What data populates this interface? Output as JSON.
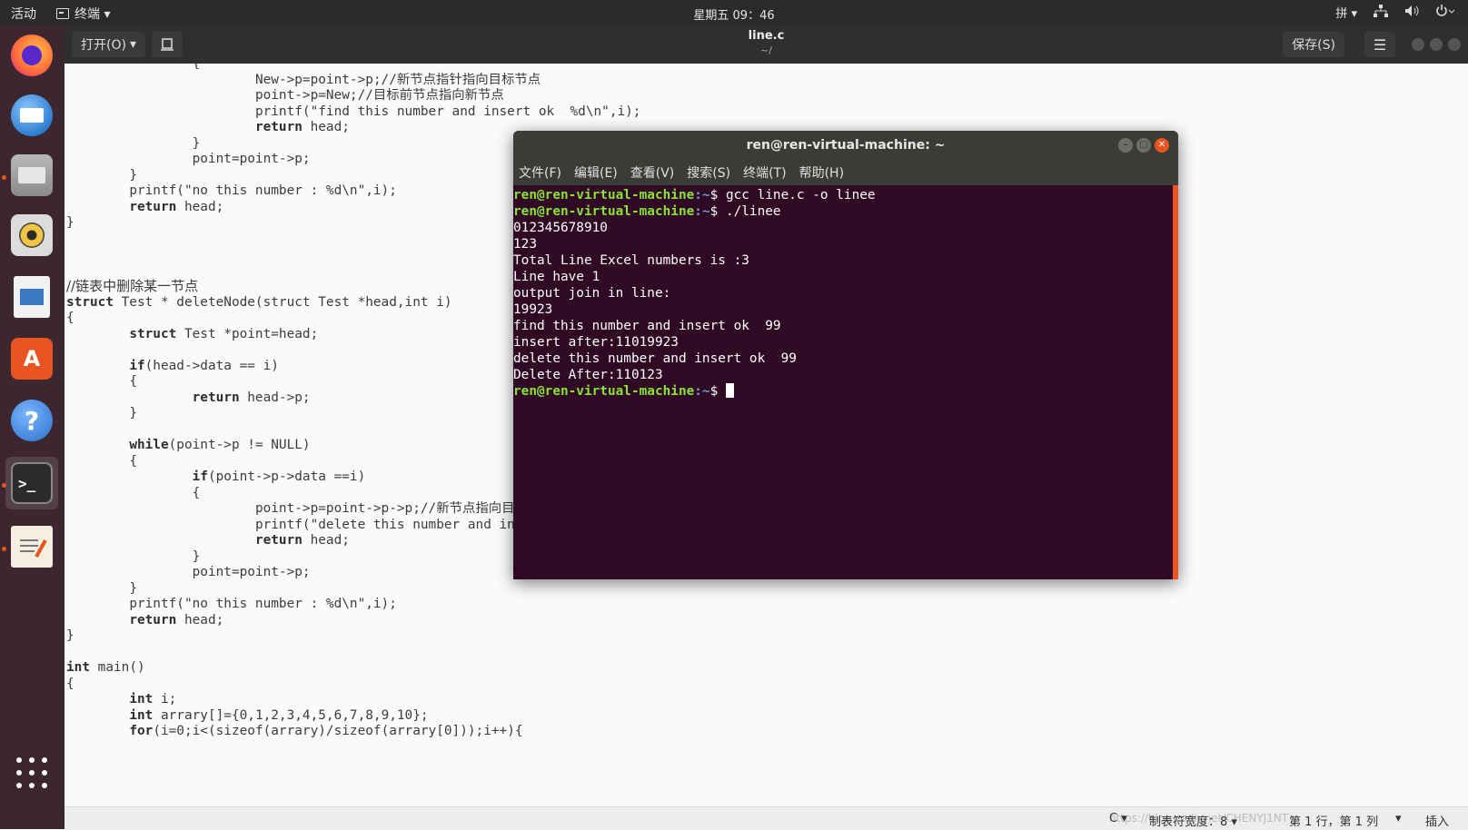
{
  "topbar": {
    "activities": "活动",
    "app_menu": "终端 ▾",
    "clock": "星期五 09：46",
    "input_method": "拼 ▾"
  },
  "dock": {
    "items": [
      {
        "name": "firefox",
        "color": "#ff7139"
      },
      {
        "name": "thunderbird",
        "color": "#2f7fd0"
      },
      {
        "name": "files",
        "color": "#8a8a8a"
      },
      {
        "name": "rhythmbox",
        "color": "#f4c542"
      },
      {
        "name": "libreoffice-writer",
        "color": "#3b7bc5"
      },
      {
        "name": "software",
        "color": "#e95420"
      },
      {
        "name": "help",
        "color": "#3d8ee0"
      },
      {
        "name": "terminal",
        "color": "#2b2b2b"
      },
      {
        "name": "text-editor",
        "color": "#e8e0c8"
      }
    ]
  },
  "editor": {
    "open_label": "打开(O)",
    "title": "line.c",
    "subtitle": "~/",
    "save_label": "保存(S)",
    "code_lines": [
      {
        "i": "\t\t",
        "t": "{"
      },
      {
        "i": "\t\t\t",
        "t": "New->p=point->p;//新节点指针指向目标节点"
      },
      {
        "i": "\t\t\t",
        "t": "point->p=New;//目标前节点指向新节点"
      },
      {
        "i": "\t\t\t",
        "t": "printf(\"find this number and insert ok  %d\\n\",i);"
      },
      {
        "i": "\t\t\t",
        "k": "return",
        "t": " head;"
      },
      {
        "i": "\t\t",
        "t": "}"
      },
      {
        "i": "\t\t",
        "t": "point=point->p;"
      },
      {
        "i": "\t",
        "t": "}"
      },
      {
        "i": "\t",
        "t": "printf(\"no this number : %d\\n\",i);"
      },
      {
        "i": "\t",
        "k": "return",
        "t": " head;"
      },
      {
        "i": "",
        "t": "}"
      },
      {
        "i": "",
        "t": ""
      },
      {
        "i": "",
        "t": ""
      },
      {
        "i": "",
        "t": ""
      },
      {
        "i": "",
        "t": "//链表中删除某一节点"
      },
      {
        "i": "",
        "k": "struct",
        "t": " Test * deleteNode(struct Test *head,int i)"
      },
      {
        "i": "",
        "t": "{"
      },
      {
        "i": "\t",
        "k": "struct",
        "t": " Test *point=head;"
      },
      {
        "i": "",
        "t": ""
      },
      {
        "i": "\t",
        "k": "if",
        "t": "(head->data == i)"
      },
      {
        "i": "\t",
        "t": "{"
      },
      {
        "i": "\t\t",
        "k": "return",
        "t": " head->p;"
      },
      {
        "i": "\t",
        "t": "}"
      },
      {
        "i": "",
        "t": ""
      },
      {
        "i": "\t",
        "k": "while",
        "t": "(point->p != NULL)"
      },
      {
        "i": "\t",
        "t": "{"
      },
      {
        "i": "\t\t",
        "k": "if",
        "t": "(point->p->data ==i)"
      },
      {
        "i": "\t\t",
        "t": "{"
      },
      {
        "i": "\t\t\t",
        "t": "point->p=point->p->p;//新节点指向目标后节点"
      },
      {
        "i": "\t\t\t",
        "t": "printf(\"delete this number and insert ok  %d\\n\",i);"
      },
      {
        "i": "\t\t\t",
        "k": "return",
        "t": " head;"
      },
      {
        "i": "\t\t",
        "t": "}"
      },
      {
        "i": "\t\t",
        "t": "point=point->p;"
      },
      {
        "i": "\t",
        "t": "}"
      },
      {
        "i": "\t",
        "t": "printf(\"no this number : %d\\n\",i);"
      },
      {
        "i": "\t",
        "k": "return",
        "t": " head;"
      },
      {
        "i": "",
        "t": "}"
      },
      {
        "i": "",
        "t": ""
      },
      {
        "i": "",
        "k": "int",
        "t": " main()"
      },
      {
        "i": "",
        "t": "{"
      },
      {
        "i": "\t",
        "k": "int",
        "t": " i;"
      },
      {
        "i": "\t",
        "k": "int",
        "t": " arrary[]={0,1,2,3,4,5,6,7,8,9,10};"
      },
      {
        "i": "\t",
        "k": "for",
        "t": "(i=0;i<(sizeof(arrary)/sizeof(arrary[0]));i++){"
      }
    ]
  },
  "statusbar": {
    "language": "C ▾",
    "tab_width": "制表符宽度：8 ▾",
    "position": "第 1 行，第 1 列",
    "mode": "插入",
    "watermark": "https://blog.csdn.net/CHENYJ1NT"
  },
  "terminal": {
    "title": "ren@ren-virtual-machine: ~",
    "menu": [
      "文件(F)",
      "编辑(E)",
      "查看(V)",
      "搜索(S)",
      "终端(T)",
      "帮助(H)"
    ],
    "prompt_user": "ren@ren-virtual-machine",
    "prompt_path": ":~$",
    "lines": [
      {
        "type": "cmd",
        "text": " gcc line.c -o linee"
      },
      {
        "type": "cmd",
        "text": " ./linee"
      },
      {
        "type": "out",
        "text": "012345678910"
      },
      {
        "type": "out",
        "text": "123"
      },
      {
        "type": "out",
        "text": "Total Line Excel numbers is :3"
      },
      {
        "type": "out",
        "text": "Line have 1"
      },
      {
        "type": "out",
        "text": "output join in line:"
      },
      {
        "type": "out",
        "text": "19923"
      },
      {
        "type": "out",
        "text": "find this number and insert ok  99"
      },
      {
        "type": "out",
        "text": "insert after:11019923"
      },
      {
        "type": "out",
        "text": "delete this number and insert ok  99"
      },
      {
        "type": "out",
        "text": "Delete After:110123"
      },
      {
        "type": "cursor",
        "text": " "
      }
    ]
  }
}
